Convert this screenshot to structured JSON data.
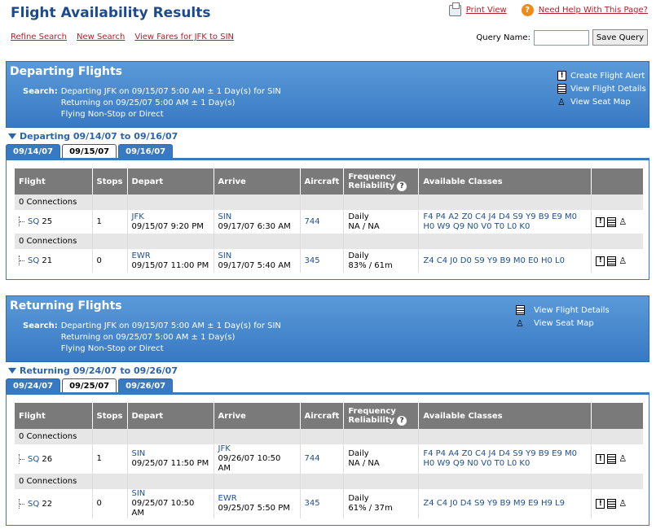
{
  "page_title": "Flight Availability Results",
  "top": {
    "print_label": "Print View",
    "help_label": "Need Help With This Page?"
  },
  "actions": {
    "refine": "Refine Search",
    "new": "New Search",
    "fares": "View Fares for JFK to SIN"
  },
  "query": {
    "label": "Query Name:",
    "value": "",
    "save": "Save Query"
  },
  "columns": {
    "flight": "Flight",
    "stops": "Stops",
    "depart": "Depart",
    "arrive": "Arrive",
    "aircraft": "Aircraft",
    "freq1": "Frequency",
    "freq2": "Reliability",
    "classes": "Available Classes"
  },
  "departing": {
    "heading": "Departing Flights",
    "search_label": "Search:",
    "search_lines": [
      "Departing JFK on 09/15/07 5:00 AM ± 1 Day(s) for SIN",
      "Returning on 09/25/07 5:00 AM ± 1 Day(s)",
      "Flying Non-Stop or Direct"
    ],
    "links": {
      "alert": "Create Flight Alert",
      "details": "View Flight Details",
      "seat": "View Seat Map"
    },
    "range": "Departing 09/14/07 to 09/16/07",
    "tabs": [
      "09/14/07",
      "09/15/07",
      "09/16/07"
    ],
    "active_tab": 1,
    "rows": [
      {
        "connections": "0 Connections",
        "airline": "SQ",
        "number": "25",
        "stops": "1",
        "dep_city": "JFK",
        "dep_time": "09/15/07 9:20 PM",
        "arr_city": "SIN",
        "arr_time": "09/17/07 6:30 AM",
        "aircraft": "744",
        "freq": "Daily",
        "rel": "NA / NA",
        "classes1": "F4 P4 A2 Z0 C4 J4 D4 S9 Y9 B9 E9 M0",
        "classes2": "H0 W9 Q9 N0 V0 T0 L0 K0"
      },
      {
        "connections": "0 Connections",
        "airline": "SQ",
        "number": "21",
        "stops": "0",
        "dep_city": "EWR",
        "dep_time": "09/15/07 11:00 PM",
        "arr_city": "SIN",
        "arr_time": "09/17/07 5:40 AM",
        "aircraft": "345",
        "freq": "Daily",
        "rel": "83% / 61m",
        "classes1": "Z4 C4 J0 D0 S9 Y9 B9 M0 E0 H0 L0",
        "classes2": ""
      }
    ]
  },
  "returning": {
    "heading": "Returning Flights",
    "search_label": "Search:",
    "search_lines": [
      "Departing JFK on 09/15/07 5:00 AM ± 1 Day(s) for SIN",
      "Returning on 09/25/07 5:00 AM ± 1 Day(s)",
      "Flying Non-Stop or Direct"
    ],
    "links": {
      "details": "View Flight Details",
      "seat": "View Seat Map"
    },
    "range": "Returning 09/24/07 to 09/26/07",
    "tabs": [
      "09/24/07",
      "09/25/07",
      "09/26/07"
    ],
    "active_tab": 1,
    "rows": [
      {
        "connections": "0 Connections",
        "airline": "SQ",
        "number": "26",
        "stops": "1",
        "dep_city": "SIN",
        "dep_time": "09/25/07 11:50 PM",
        "arr_city": "JFK",
        "arr_time": "09/26/07 10:50 AM",
        "aircraft": "744",
        "freq": "Daily",
        "rel": "NA / NA",
        "classes1": "F4 P4 A4 Z0 C4 J4 D4 S9 Y9 B9 E9 M0",
        "classes2": "H0 W9 Q9 N0 V0 T0 L0 K0"
      },
      {
        "connections": "0 Connections",
        "airline": "SQ",
        "number": "22",
        "stops": "0",
        "dep_city": "SIN",
        "dep_time": "09/25/07 10:50 AM",
        "arr_city": "EWR",
        "arr_time": "09/25/07 5:50 PM",
        "aircraft": "345",
        "freq": "Daily",
        "rel": "61% / 37m",
        "classes1": "Z4 C4 J0 D4 S9 Y9 B9 M9 E9 H9 L9",
        "classes2": ""
      }
    ]
  },
  "colors": {
    "banner": "#3879c4",
    "link": "#1f4f8f",
    "action_link": "#b3202a",
    "title": "#1d4a8c",
    "header": "#7a7a7a"
  },
  "icons": {
    "print": "printer-icon",
    "help": "help-icon",
    "alert": "alert-icon",
    "details": "details-icon",
    "seat": "seat-icon"
  }
}
